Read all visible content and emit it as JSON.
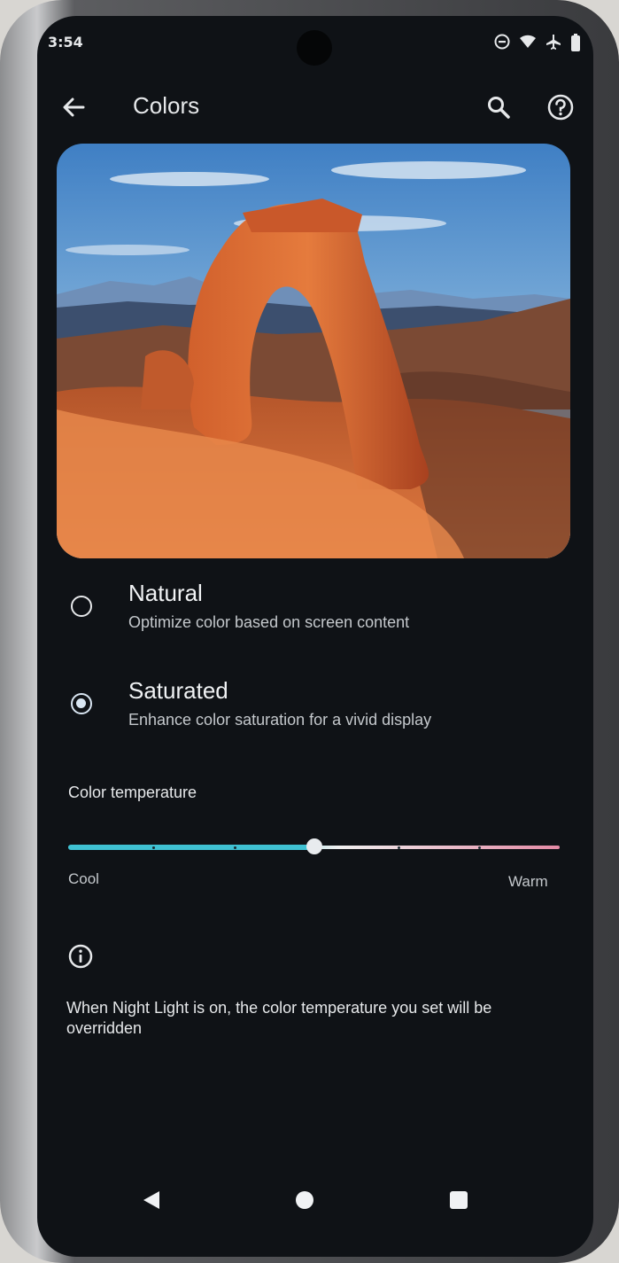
{
  "status_bar": {
    "time": "3:54",
    "icons": [
      "do-not-disturb-icon",
      "wifi-icon",
      "airplane-icon",
      "battery-icon"
    ]
  },
  "app_bar": {
    "title": "Colors",
    "back_icon": "arrow-left-icon",
    "search_icon": "search-icon",
    "help_icon": "help-icon"
  },
  "preview_image": {
    "subject": "sandstone arch landscape"
  },
  "color_modes": [
    {
      "title": "Natural",
      "subtitle": "Optimize color based on screen content",
      "selected": false
    },
    {
      "title": "Saturated",
      "subtitle": "Enhance color saturation for a vivid display",
      "selected": true
    }
  ],
  "color_temperature": {
    "label": "Color temperature",
    "min_label": "Cool",
    "max_label": "Warm",
    "value_percent": 50
  },
  "info": {
    "icon": "info-icon",
    "text": "When Night Light is on, the color temperature you set will be overridden"
  },
  "nav_bar": {
    "back_icon": "nav-back-icon",
    "home_icon": "nav-home-icon",
    "recents_icon": "nav-recents-icon"
  },
  "colors": {
    "background": "#0f1216",
    "accent": "#3fc1d2",
    "text": "#e6e8ea"
  }
}
